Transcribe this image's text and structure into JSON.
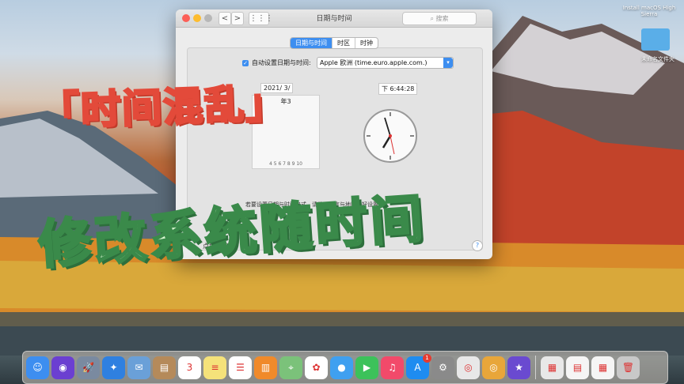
{
  "window": {
    "title": "日期与时间",
    "search_placeholder": "搜索",
    "nav_back": "<",
    "nav_forward": ">",
    "grid_glyph": "⋮⋮⋮",
    "tabs": [
      {
        "label": "日期与时间",
        "active": true
      },
      {
        "label": "时区",
        "active": false
      },
      {
        "label": "时钟",
        "active": false
      }
    ],
    "auto_set_label": "自动设置日期与时间:",
    "auto_set_checked": true,
    "time_server": "Apple 欧洲 (time.euro.apple.com.)",
    "date_value": "2021/ 3/",
    "time_value": "下 6:44:28",
    "calendar_header": "年3",
    "calendar_rows": [
      "4  5  6  7  8  9  10"
    ],
    "bottom_text": "若要设置日期与时间格式，请使用语言与地区偏好设置。",
    "lock_text": "点按锁按",
    "help_glyph": "?"
  },
  "desktop": {
    "install_label": "Install macOS High Sierra",
    "folder_label": "未命名文件夹"
  },
  "overlay": {
    "top_text": "「时间混乱」",
    "bottom_text": "修改系统随时间"
  },
  "dock": {
    "items": [
      {
        "name": "finder-icon",
        "color": "#3d8ef0",
        "glyph": "☺"
      },
      {
        "name": "siri-icon",
        "color": "#6b3fd1",
        "glyph": "◉"
      },
      {
        "name": "launchpad-icon",
        "color": "#7a8aa0",
        "glyph": "🚀"
      },
      {
        "name": "safari-icon",
        "color": "#2f80e0",
        "glyph": "✦"
      },
      {
        "name": "mail-icon",
        "color": "#6aa0d8",
        "glyph": "✉"
      },
      {
        "name": "contacts-icon",
        "color": "#b58a5a",
        "glyph": "▤"
      },
      {
        "name": "calendar-icon",
        "color": "#ffffff",
        "glyph": "3"
      },
      {
        "name": "notes-icon",
        "color": "#f5e27a",
        "glyph": "≡"
      },
      {
        "name": "reminders-icon",
        "color": "#ffffff",
        "glyph": "☰"
      },
      {
        "name": "books-icon",
        "color": "#f08a2a",
        "glyph": "▥"
      },
      {
        "name": "maps-icon",
        "color": "#7bc27a",
        "glyph": "⌖"
      },
      {
        "name": "photos-icon",
        "color": "#ffffff",
        "glyph": "✿"
      },
      {
        "name": "messages-icon",
        "color": "#3fa0f0",
        "glyph": "●"
      },
      {
        "name": "facetime-icon",
        "color": "#3cc25a",
        "glyph": "▶"
      },
      {
        "name": "music-icon",
        "color": "#f24a6a",
        "glyph": "♫"
      },
      {
        "name": "app-store-icon",
        "color": "#1e8cf0",
        "glyph": "A",
        "badge": "1"
      },
      {
        "name": "system-preferences-icon",
        "color": "#8a8a8a",
        "glyph": "⚙"
      },
      {
        "name": "chrome-icon",
        "color": "#e8e8e8",
        "glyph": "◎"
      },
      {
        "name": "chrome-canary-icon",
        "color": "#e8a63a",
        "glyph": "◎"
      },
      {
        "name": "imovie-icon",
        "color": "#6a4ad0",
        "glyph": "★"
      },
      {
        "name": "preview-icon",
        "color": "#e8e8e8",
        "glyph": "▦"
      },
      {
        "name": "document-icon",
        "color": "#f5f5f5",
        "glyph": "▤"
      },
      {
        "name": "spreadsheet-icon",
        "color": "#f5f5f5",
        "glyph": "▦"
      },
      {
        "name": "trash-icon",
        "color": "#c8c8c8",
        "glyph": "🗑"
      }
    ]
  }
}
